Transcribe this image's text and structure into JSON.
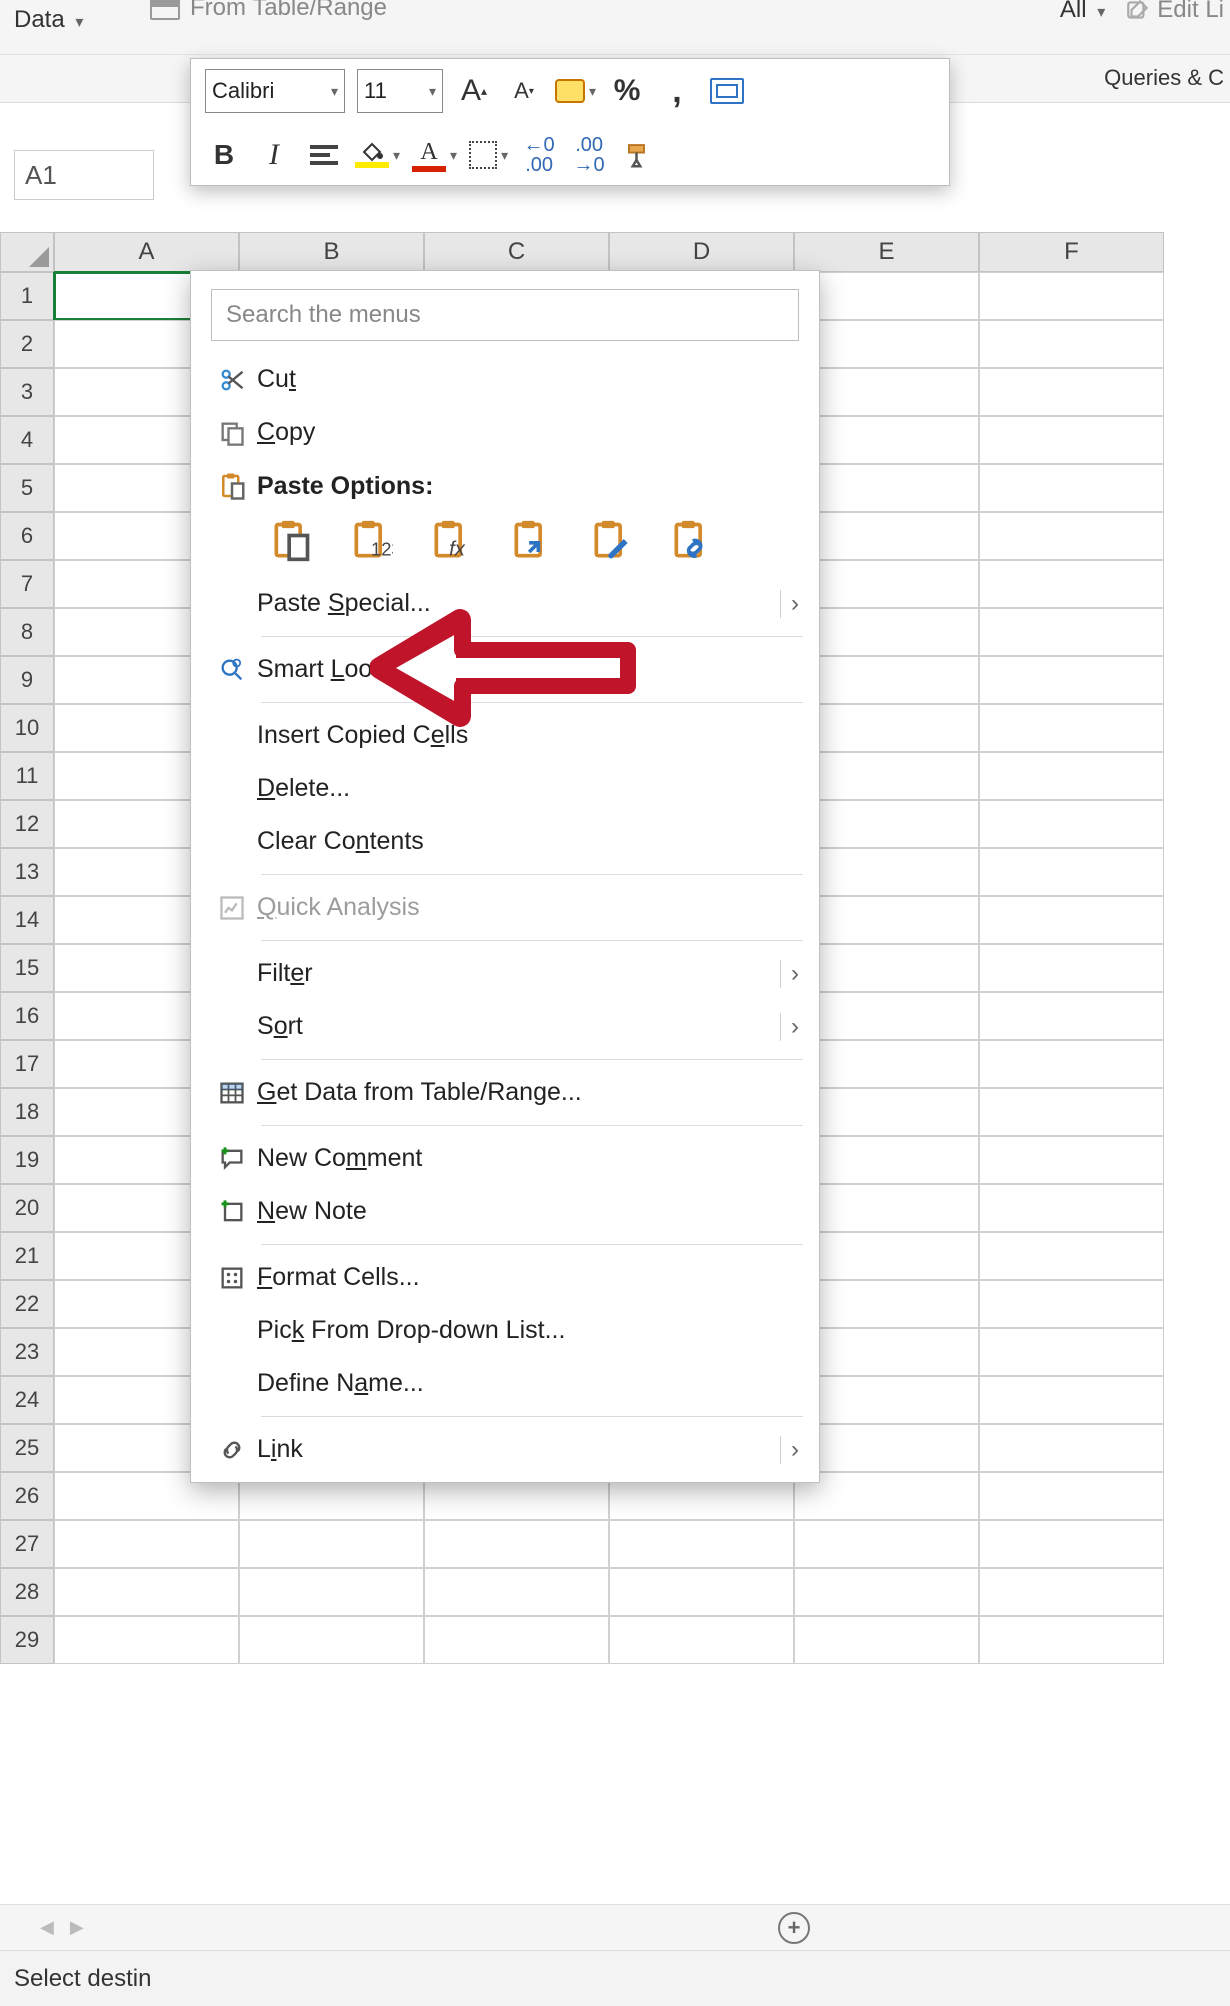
{
  "ribbon": {
    "data_tab": "Data",
    "from_table": "From Table/Range",
    "all": "All",
    "edit_links": "Edit Li",
    "queries": "Queries & C"
  },
  "mini_toolbar": {
    "font_name": "Calibri",
    "font_size": "11"
  },
  "name_box": {
    "value": "A1"
  },
  "columns": [
    "A",
    "B",
    "C",
    "D",
    "E",
    "F"
  ],
  "row_count": 29,
  "context_menu": {
    "search_placeholder": "Search the menus",
    "cut": "Cut",
    "copy": "Copy",
    "paste_options": "Paste Options:",
    "paste_special": "Paste Special...",
    "smart_lookup": "Smart Lookup",
    "insert_copied": "Insert Copied Cells",
    "delete": "Delete...",
    "clear_contents": "Clear Contents",
    "quick_analysis": "Quick Analysis",
    "filter": "Filter",
    "sort": "Sort",
    "get_data": "Get Data from Table/Range...",
    "new_comment": "New Comment",
    "new_note": "New Note",
    "format_cells": "Format Cells...",
    "pick_list": "Pick From Drop-down List...",
    "define_name": "Define Name...",
    "link": "Link"
  },
  "status_bar": {
    "text": "Select destin"
  }
}
